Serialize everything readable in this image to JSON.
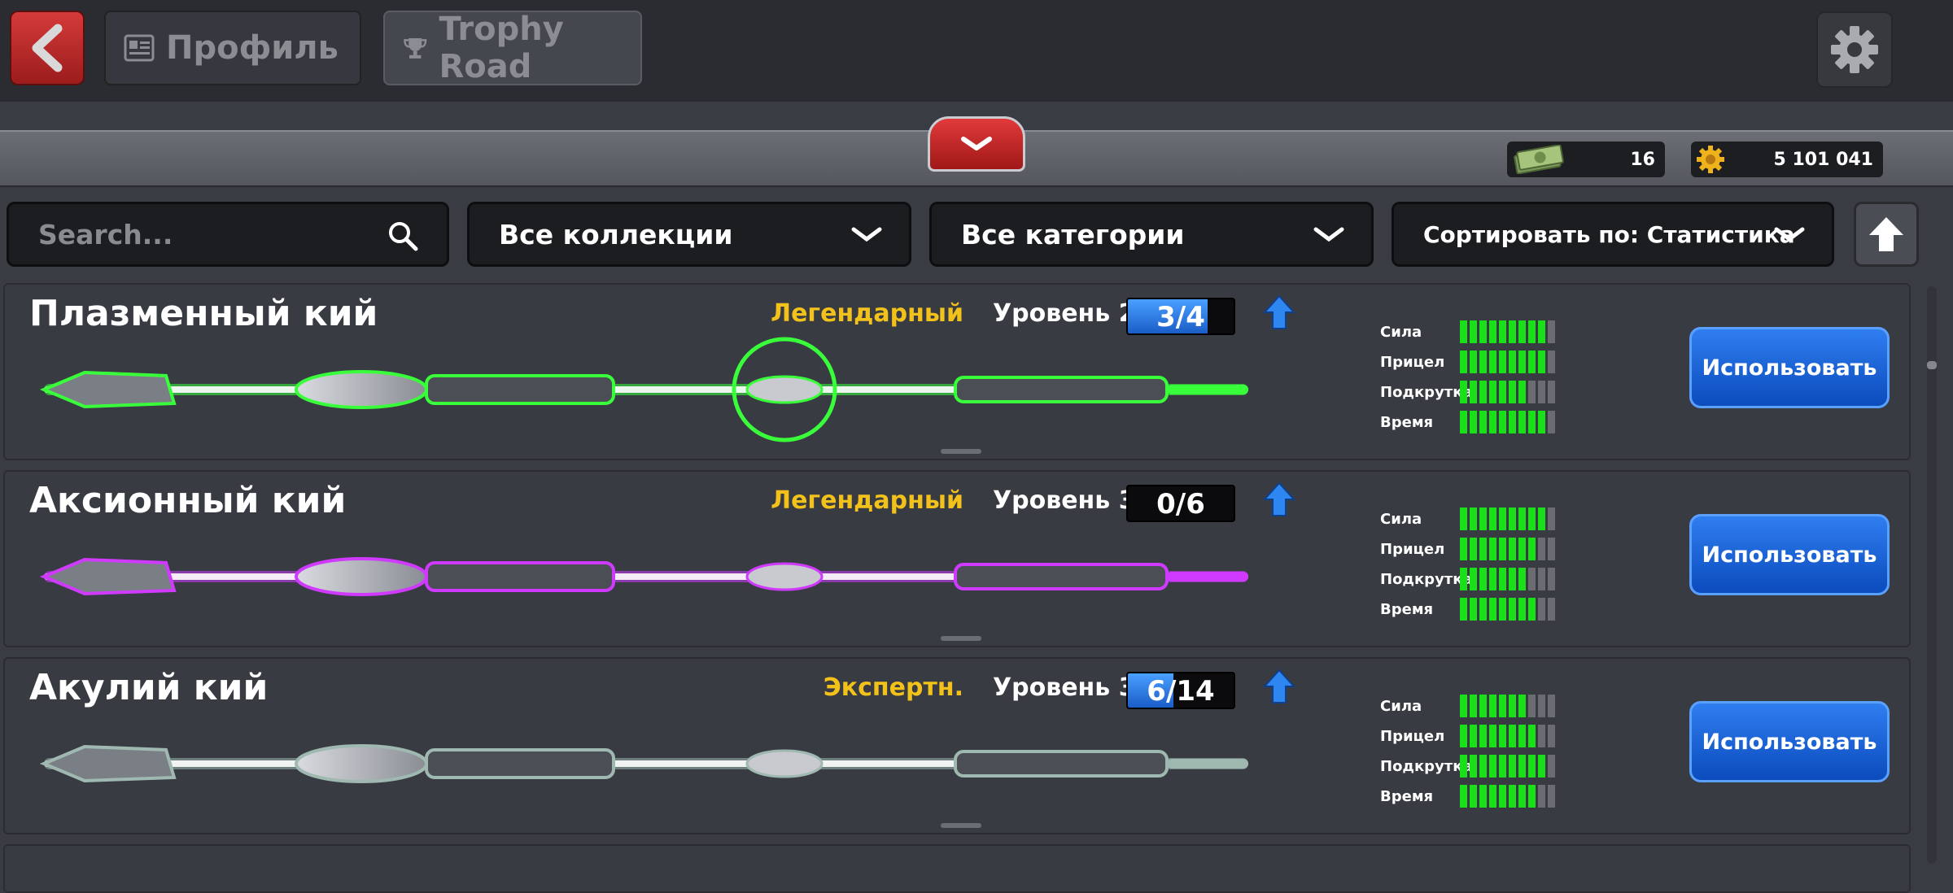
{
  "header": {
    "tab_profile": "Профиль",
    "tab_trophy": "Trophy Road"
  },
  "currency": {
    "cash": "16",
    "coins": "5 101 041"
  },
  "filters": {
    "search_placeholder": "Search...",
    "collections": "Все коллекции",
    "categories": "Все категории",
    "sort": "Сортировать по: Статистика"
  },
  "stat_labels": [
    "Сила",
    "Прицел",
    "Подкрутка",
    "Время"
  ],
  "use_label": "Использовать",
  "cues": [
    {
      "name": "Плазменный кий",
      "rarity": "Легендарный",
      "level": "Уровень 2",
      "progress_text": "3/4",
      "progress": 0.75,
      "accent": "#39ff3a",
      "stats": [
        9,
        9,
        7,
        9
      ]
    },
    {
      "name": "Аксионный кий",
      "rarity": "Легендарный",
      "level": "Уровень 3",
      "progress_text": "0/6",
      "progress": 0.0,
      "accent": "#d03aff",
      "stats": [
        9,
        8,
        7,
        8
      ]
    },
    {
      "name": "Акулий кий",
      "rarity": "Экспертн.",
      "level": "Уровень 3",
      "progress_text": "6/14",
      "progress": 0.43,
      "accent": "#9fb8b0",
      "stats": [
        7,
        8,
        9,
        8
      ]
    }
  ],
  "colors": {
    "legendary": "#f2c21a",
    "stat_on": "#19e019",
    "use_button": "#1a64dc"
  }
}
